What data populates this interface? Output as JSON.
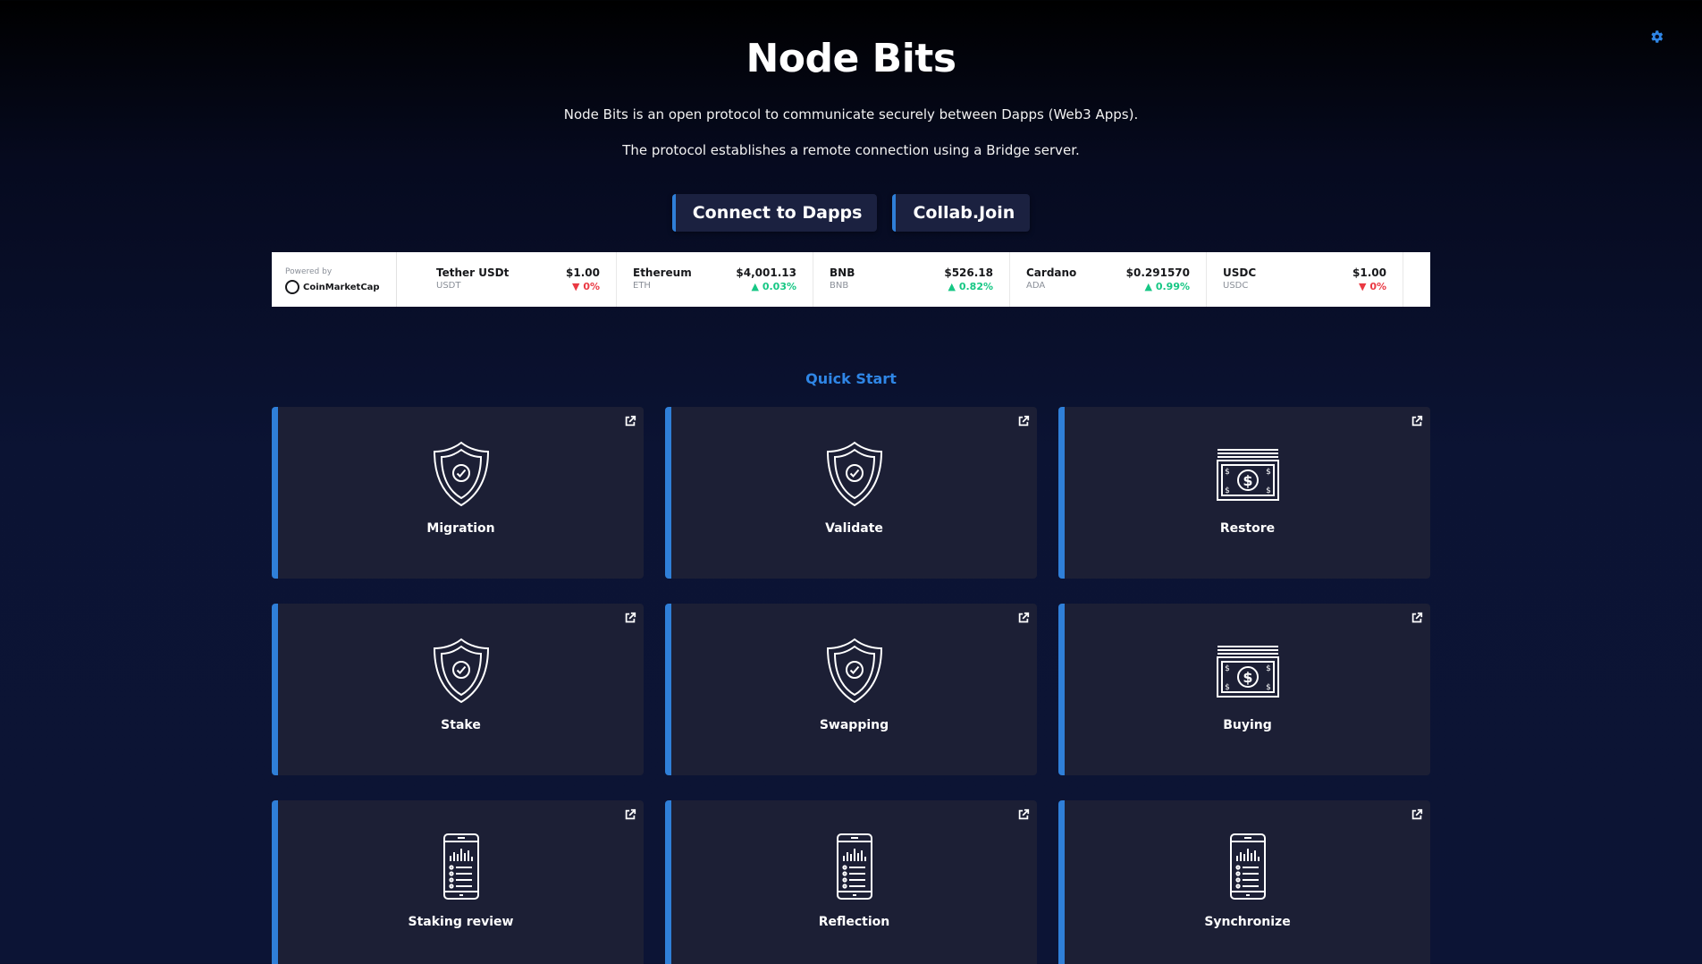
{
  "header": {
    "title": "Node Bits",
    "subtitle_line1": "Node Bits is an open protocol to communicate securely between Dapps (Web3 Apps).",
    "subtitle_line2": "The protocol establishes a remote connection using a Bridge server."
  },
  "settings_icon": "gear-icon",
  "buttons": {
    "connect": "Connect to Dapps",
    "collab": "Collab.Join"
  },
  "ticker": {
    "powered_by": "Powered by",
    "brand": "CoinMarketCap",
    "coins": [
      {
        "name": "Tether USDt",
        "symbol": "USDT",
        "price": "$1.00",
        "change": "0%",
        "direction": "down"
      },
      {
        "name": "Ethereum",
        "symbol": "ETH",
        "price": "$4,001.13",
        "change": "0.03%",
        "direction": "up"
      },
      {
        "name": "BNB",
        "symbol": "BNB",
        "price": "$526.18",
        "change": "0.82%",
        "direction": "up"
      },
      {
        "name": "Cardano",
        "symbol": "ADA",
        "price": "$0.291570",
        "change": "0.99%",
        "direction": "up"
      },
      {
        "name": "USDC",
        "symbol": "USDC",
        "price": "$1.00",
        "change": "0%",
        "direction": "down"
      }
    ]
  },
  "quick_start": {
    "heading": "Quick Start",
    "cards": [
      {
        "label": "Migration",
        "icon": "shield-check-icon"
      },
      {
        "label": "Validate",
        "icon": "shield-check-icon"
      },
      {
        "label": "Restore",
        "icon": "dollar-bill-icon"
      },
      {
        "label": "Stake",
        "icon": "shield-check-icon"
      },
      {
        "label": "Swapping",
        "icon": "shield-check-icon"
      },
      {
        "label": "Buying",
        "icon": "dollar-bill-icon"
      },
      {
        "label": "Staking review",
        "icon": "mobile-chart-icon"
      },
      {
        "label": "Reflection",
        "icon": "mobile-chart-icon"
      },
      {
        "label": "Synchronize",
        "icon": "mobile-chart-icon"
      }
    ]
  },
  "colors": {
    "accent": "#2f7fd8",
    "heading_accent": "#2f86e6",
    "card_bg": "#1c1f35",
    "price_up": "#16c784",
    "price_down": "#ea3943"
  }
}
